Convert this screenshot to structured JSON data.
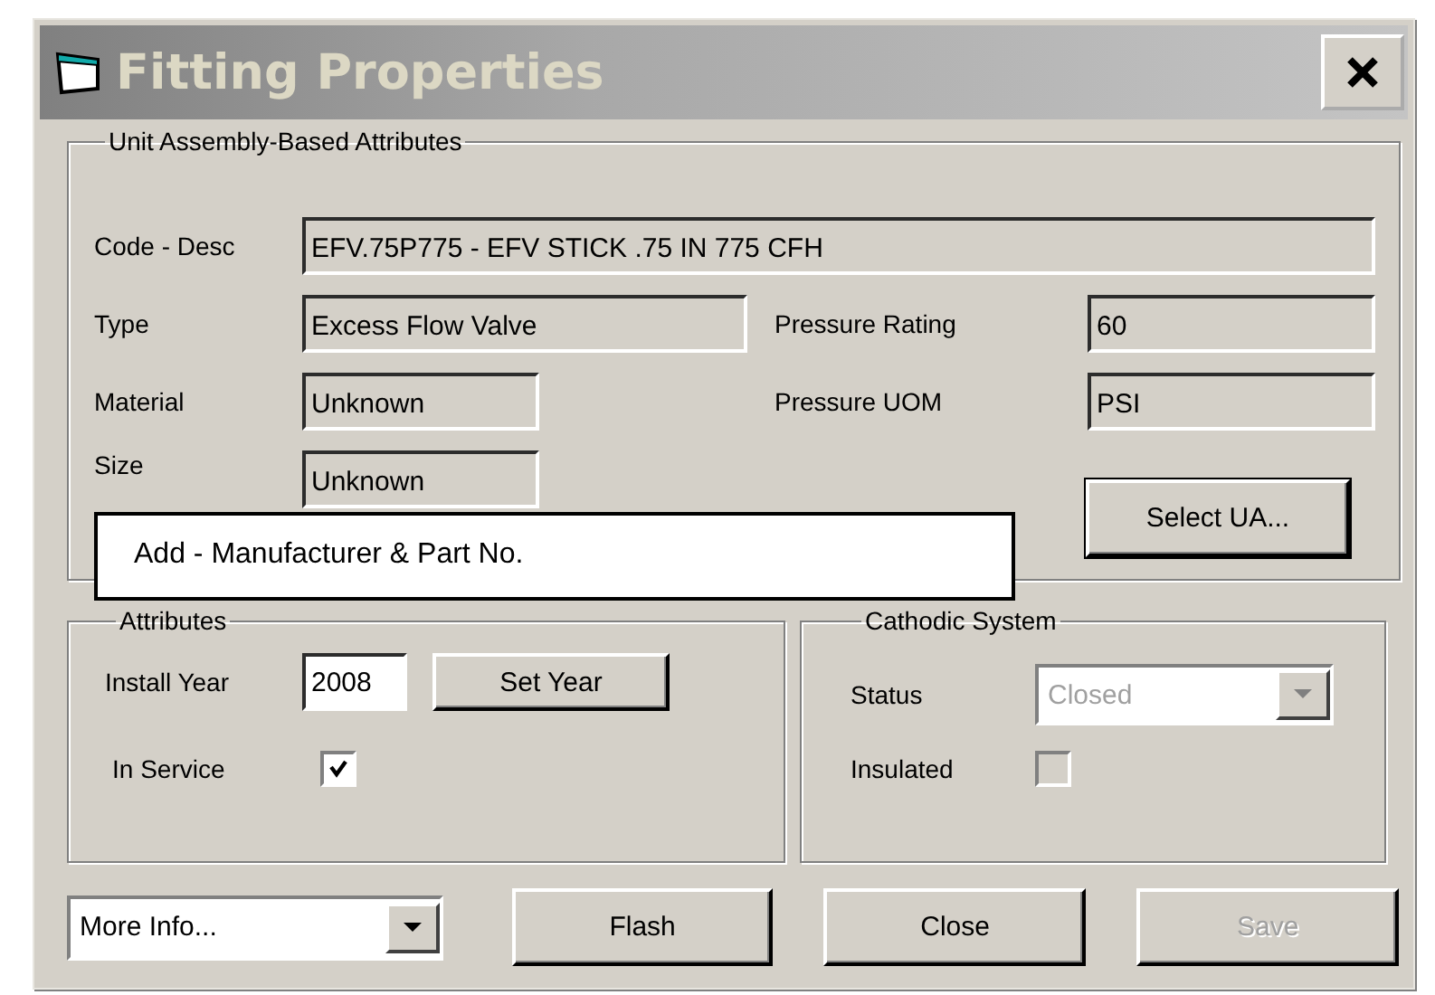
{
  "window": {
    "title": "Fitting Properties"
  },
  "unit_assembly": {
    "legend": "Unit Assembly-Based Attributes",
    "code_desc": {
      "label": "Code - Desc",
      "value": "EFV.75P775 - EFV STICK .75 IN 775 CFH"
    },
    "type": {
      "label": "Type",
      "value": "Excess Flow Valve"
    },
    "pressure_rating": {
      "label": "Pressure Rating",
      "value": "60"
    },
    "material": {
      "label": "Material",
      "value": "Unknown"
    },
    "pressure_uom": {
      "label": "Pressure UOM",
      "value": "PSI"
    },
    "size": {
      "label": "Size",
      "value": "Unknown"
    },
    "select_button": "Select UA..."
  },
  "callout": {
    "text": "Add - Manufacturer & Part No."
  },
  "attributes": {
    "legend": "Attributes",
    "install_year": {
      "label": "Install Year",
      "value": "2008"
    },
    "set_year_button": "Set Year",
    "in_service": {
      "label": "In Service",
      "checked": true
    }
  },
  "cathodic_system": {
    "legend": "Cathodic System",
    "status": {
      "label": "Status",
      "value": "Closed",
      "disabled": true
    },
    "insulated": {
      "label": "Insulated",
      "checked": false,
      "disabled": true
    }
  },
  "footer": {
    "more_info": {
      "value": "More Info...",
      "disabled": false
    },
    "buttons": [
      {
        "label": "Flash",
        "disabled": false
      },
      {
        "label": "Close",
        "disabled": false
      },
      {
        "label": "Save",
        "disabled": true
      }
    ]
  }
}
